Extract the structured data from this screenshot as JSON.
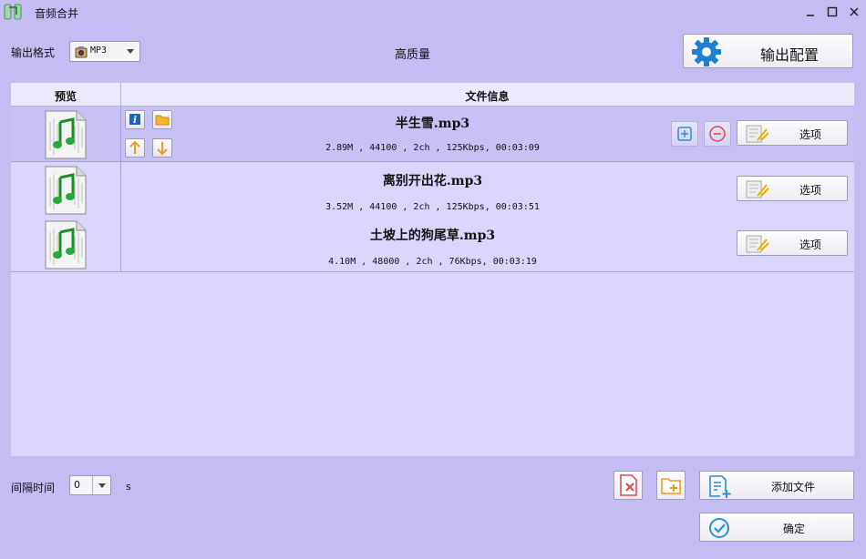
{
  "window": {
    "title": "音频合并",
    "app_icon": "audio-merge-icon",
    "controls": [
      "minimize-icon",
      "maximize-icon",
      "close-icon"
    ]
  },
  "toolbar": {
    "format_label": "输出格式",
    "format_value": "MP3",
    "quality_label": "高质量",
    "output_config_label": "输出配置"
  },
  "table": {
    "columns": [
      "预览",
      "文件信息"
    ],
    "rows": [
      {
        "name": "半生雪.mp3",
        "info": "2.89M , 44100 , 2ch , 125Kbps, 00:03:09",
        "option_label": "选项",
        "selected": true
      },
      {
        "name": "离别开出花.mp3",
        "info": "3.52M , 44100 , 2ch , 125Kbps, 00:03:51",
        "option_label": "选项",
        "selected": false
      },
      {
        "name": "土坡上的狗尾草.mp3",
        "info": "4.10M , 48000 , 2ch , 76Kbps, 00:03:19",
        "option_label": "选项",
        "selected": false
      }
    ]
  },
  "bottom": {
    "interval_label": "间隔时间",
    "interval_value": "0",
    "interval_unit": "s",
    "add_file_label": "添加文件",
    "ok_label": "确定"
  },
  "colors": {
    "window_bg": "#c4bcf3",
    "table_bg": "#dad6fb",
    "selected_row": "#c8c1f6",
    "accent_blue": "#2a8fd8",
    "accent_orange": "#f19a1b",
    "accent_red": "#e0464f"
  }
}
